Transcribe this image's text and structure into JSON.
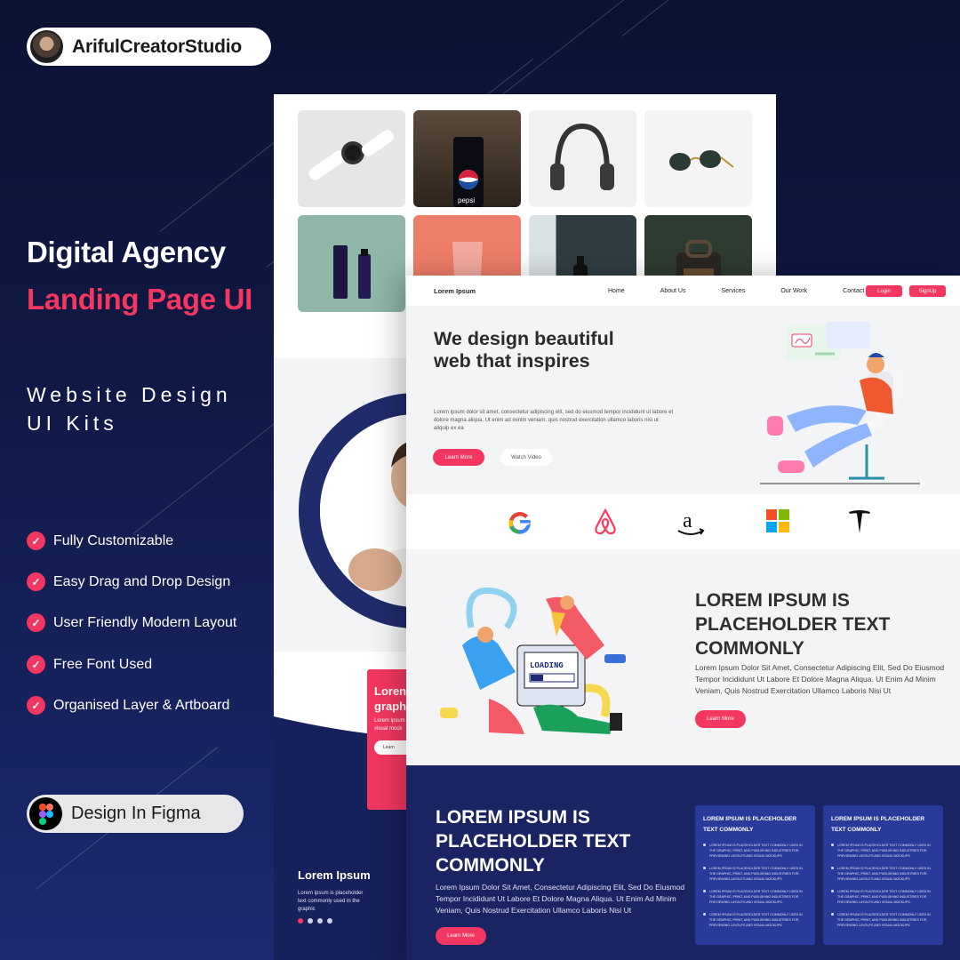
{
  "brand": {
    "name": "ArifulCreatorStudio"
  },
  "headline": {
    "line1": "Digital Agency",
    "line2": "Landing Page UI"
  },
  "subtitle": {
    "line1": "Website Design",
    "line2": "UI Kits"
  },
  "features": [
    "Fully Customizable",
    "Easy Drag and Drop Design",
    "User Friendly Modern Layout",
    "Free Font Used",
    "Organised Layer & Artboard"
  ],
  "figma_badge": {
    "label": "Design In Figma"
  },
  "colors": {
    "accent": "#f43760",
    "navy": "#1a2463",
    "bg": "#0e1538"
  },
  "back_mock": {
    "gallery": [
      "watch",
      "pepsi can",
      "headphones",
      "sunglasses",
      "cosmetics",
      "cup",
      "bottle",
      "backpack"
    ],
    "pepsi_label": "pepsi",
    "promo_title": "Loren text a graph",
    "promo_body": "Lorem ipsum print, and p visual mock",
    "promo_button": "Learn",
    "footer": {
      "title": "Lorem Ipsum",
      "text": "Lorem ipsum is placeholder text commonly used in the graphic"
    }
  },
  "front_mock": {
    "nav": {
      "logo": "Lorem Ipsum",
      "links": [
        "Home",
        "About Us",
        "Services",
        "Our Work",
        "Contact"
      ],
      "login": "Login",
      "signup": "SignUp"
    },
    "hero": {
      "title": "We design beautiful web that inspires",
      "body": "Lorem ipsum dolor sit amet, consectetur adipiscing elit, sed do eiusmod tempor incididunt ut labore et dolore magna aliqua. Ut enim ad minim veniam, quis nostrud exercitation ullamco laboris nisi ut aliquip ex ea",
      "cta": "Learn More",
      "video": "Watch Video"
    },
    "partners": [
      "google",
      "airbnb",
      "amazon",
      "microsoft",
      "tesla"
    ],
    "section2": {
      "title": "LOREM IPSUM IS PLACEHOLDER TEXT COMMONLY",
      "body": "Lorem Ipsum Dolor Sit Amet, Consectetur Adipiscing Elit, Sed Do Eiusmod Tempor Incididunt Ut Labore Et Dolore Magna Aliqua. Ut Enim Ad Minim Veniam, Quis Nostrud Exercitation Ullamco Laboris Nisi Ut",
      "cta": "Learn More",
      "loading": "LOADING"
    },
    "section3": {
      "title": "LOREM IPSUM IS PLACEHOLDER TEXT COMMONLY",
      "body": "Lorem Ipsum Dolor Sit Amet, Consectetur Adipiscing Elit, Sed Do Eiusmod Tempor Incididunt Ut Labore Et Dolore Magna Aliqua. Ut Enim Ad Minim Veniam, Quis Nostrud Exercitation Ullamco Laboris Nisi Ut",
      "cta": "Learn More",
      "cards": [
        {
          "title": "LOREM IPSUM IS PLACEHOLDER TEXT COMMONLY",
          "item": "LOREM IPSUM IS PLACEHOLDER TEXT COMMONLY USED IN THE GRAPHIC, PRINT, AND PUBLISHING INDUSTRIES FOR PREVIEWING LAYOUTS AND VISUAL MOCKUPS."
        },
        {
          "title": "LOREM IPSUM IS PLACEHOLDER TEXT COMMONLY",
          "item": "LOREM IPSUM IS PLACEHOLDER TEXT COMMONLY USED IN THE GRAPHIC, PRINT, AND PUBLISHING INDUSTRIES FOR PREVIEWING LAYOUTS AND VISUAL MOCKUPS."
        }
      ]
    }
  }
}
